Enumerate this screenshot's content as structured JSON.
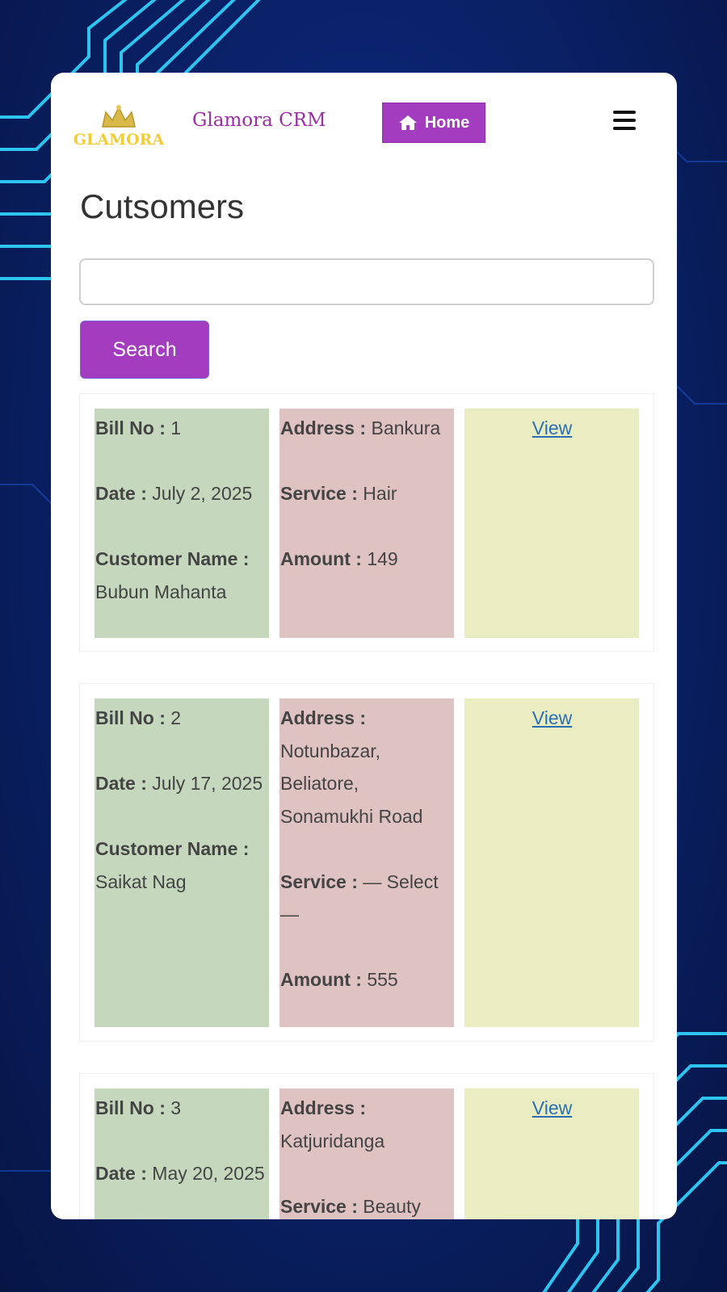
{
  "header": {
    "logo_text": "GLAMORA",
    "brand": "Glamora CRM",
    "home_label": "Home"
  },
  "page_title": "Cutsomers",
  "search": {
    "value": "",
    "placeholder": "",
    "button_label": "Search"
  },
  "labels": {
    "bill_no": "Bill No :",
    "date": "Date :",
    "customer_name": "Customer Name :",
    "address": "Address :",
    "service": "Service :",
    "amount": "Amount :",
    "view": "View"
  },
  "records": [
    {
      "bill_no": "1",
      "date": "July 2, 2025",
      "customer_name": "Bubun Mahanta",
      "address": "Bankura",
      "service": "Hair",
      "amount": "149"
    },
    {
      "bill_no": "2",
      "date": "July 17, 2025",
      "customer_name": "Saikat Nag",
      "address": "Notunbazar, Beliatore, Sonamukhi Road",
      "service": "— Select —",
      "amount": "555"
    },
    {
      "bill_no": "3",
      "date": "May 20, 2025",
      "customer_name": "",
      "address": "Katjuridanga",
      "service": "Beauty",
      "amount": ""
    }
  ],
  "colors": {
    "accent": "#a43cc0",
    "col_green": "#c5d8bd",
    "col_red": "#dfc2c2",
    "col_yellow": "#eaecc2",
    "link": "#2a6fb3"
  },
  "icons": [
    "home-icon",
    "hamburger-menu-icon"
  ]
}
